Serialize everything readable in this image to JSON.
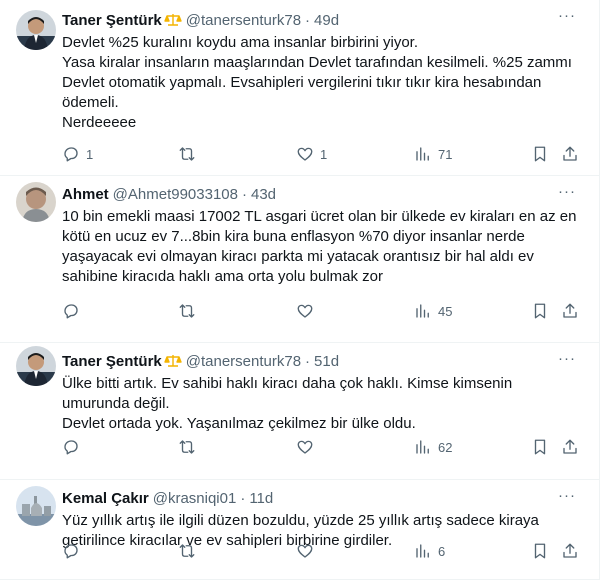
{
  "tweets": [
    {
      "name": "Taner Şentürk",
      "handle": "@tanersenturk78",
      "dot": "·",
      "time": "49d",
      "text": "Devlet %25 kuralını koydu ama insanlar birbirini yiyor.\nYasa kiralar insanların maaşlarından Devlet tarafından kesilmeli. %25 zammı Devlet otomatik yapmalı. Evsahipleri vergilerini tıkır tıkır kira hesabından ödemeli.\nNerdeeeee",
      "replies": "1",
      "retweets": "",
      "likes": "1",
      "views": "71"
    },
    {
      "name": "Ahmet",
      "handle": "@Ahmet99033108",
      "dot": "·",
      "time": "43d",
      "text": "10 bin emekli maasi 17002 TL asgari ücret olan bir ülkede ev kiraları en az en kötü en ucuz ev 7...8bin kira buna enflasyon %70 diyor insanlar nerde yaşayacak evi olmayan kiracı parkta mi yatacak orantısız bir hal aldı ev sahibine kiracıda haklı ama orta yolu bulmak zor",
      "replies": "",
      "retweets": "",
      "likes": "",
      "views": "45"
    },
    {
      "name": "Taner Şentürk",
      "handle": "@tanersenturk78",
      "dot": "·",
      "time": "51d",
      "text": "Ülke bitti artık. Ev sahibi haklı kiracı daha çok haklı. Kimse kimsenin umurunda değil.\nDevlet ortada yok. Yaşanılmaz çekilmez bir ülke oldu.",
      "replies": "",
      "retweets": "",
      "likes": "",
      "views": "62"
    },
    {
      "name": "Kemal Çakır",
      "handle": "@krasniqi01",
      "dot": "·",
      "time": "11d",
      "text": "Yüz yıllık artış ile ilgili düzen bozuldu, yüzde 25 yıllık artış sadece kiraya getirilince kiracılar ve ev sahipleri birbirine girdiler.",
      "replies": "",
      "retweets": "",
      "likes": "",
      "views": "6"
    }
  ],
  "icons": {
    "more": "more-icon",
    "reply": "reply-icon",
    "retweet": "retweet-icon",
    "like": "heart-icon",
    "views": "views-icon",
    "bookmark": "bookmark-icon",
    "share": "share-icon",
    "badge": "scales-badge-icon"
  },
  "colors": {
    "text": "#0f1419",
    "muted": "#536471",
    "border": "#eff3f4",
    "badge": "#f4b400"
  }
}
